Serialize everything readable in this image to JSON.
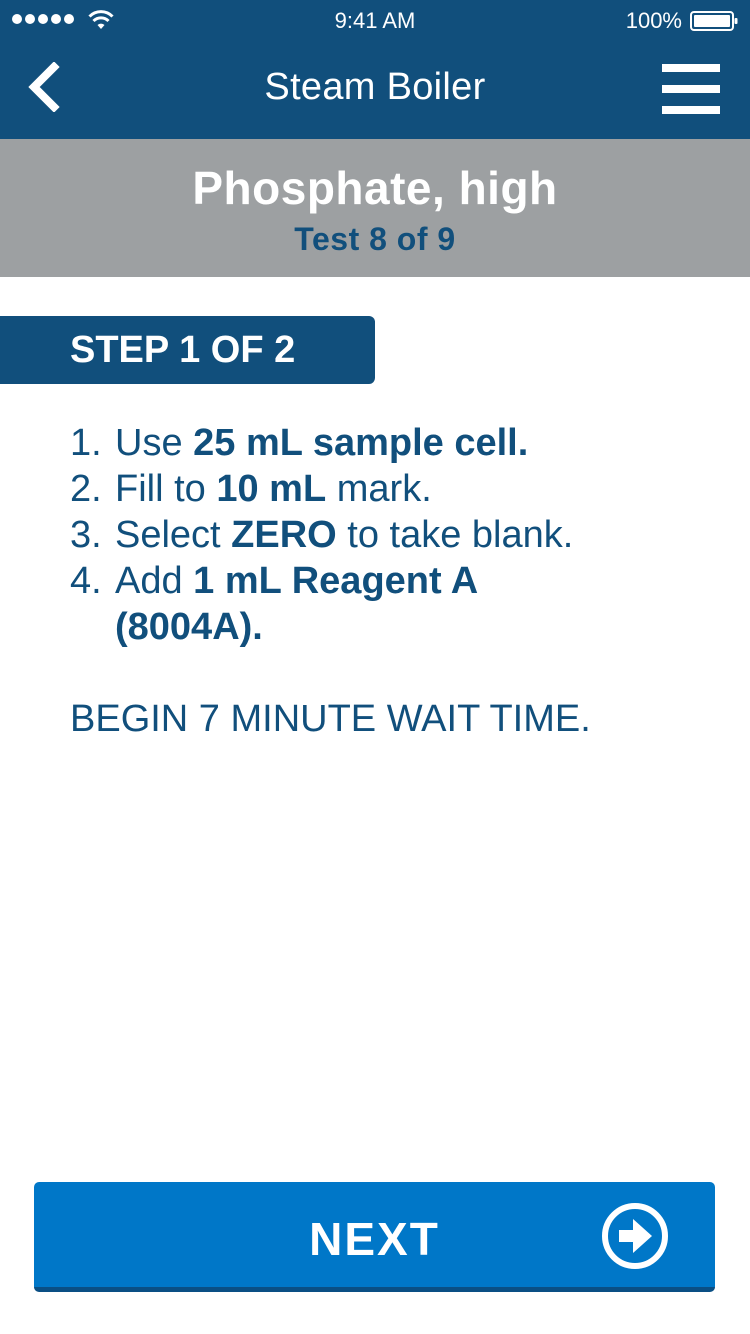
{
  "status_bar": {
    "time": "9:41 AM",
    "battery_percent": "100%",
    "signal_bars": 5,
    "icons": [
      "signal-dots-icon",
      "wifi-icon",
      "battery-icon"
    ]
  },
  "nav": {
    "title": "Steam Boiler",
    "back_icon": "chevron-left-icon",
    "menu_icon": "hamburger-menu-icon"
  },
  "test": {
    "name": "Phosphate, high",
    "progress": "Test 8 of 9"
  },
  "step": {
    "label": "STEP 1 OF 2"
  },
  "instructions": [
    {
      "num": "1.",
      "pre": "Use ",
      "bold": "25 mL sample cell.",
      "post": ""
    },
    {
      "num": "2.",
      "pre": "Fill to ",
      "bold": "10 mL",
      "post": " mark."
    },
    {
      "num": "3.",
      "pre": "Select ",
      "bold": "ZERO",
      "post": " to take blank."
    },
    {
      "num": "4.",
      "pre": "Add ",
      "bold": "1 mL Reagent A",
      "post": "",
      "continuation_bold": "(8004A)."
    }
  ],
  "wait_note": "BEGIN 7 MINUTE WAIT TIME.",
  "next_button": {
    "label": "NEXT",
    "icon": "arrow-right-circle-icon"
  },
  "colors": {
    "primary_dark": "#114f7c",
    "header_gray": "#9da0a2",
    "button_blue": "#0077c8"
  }
}
